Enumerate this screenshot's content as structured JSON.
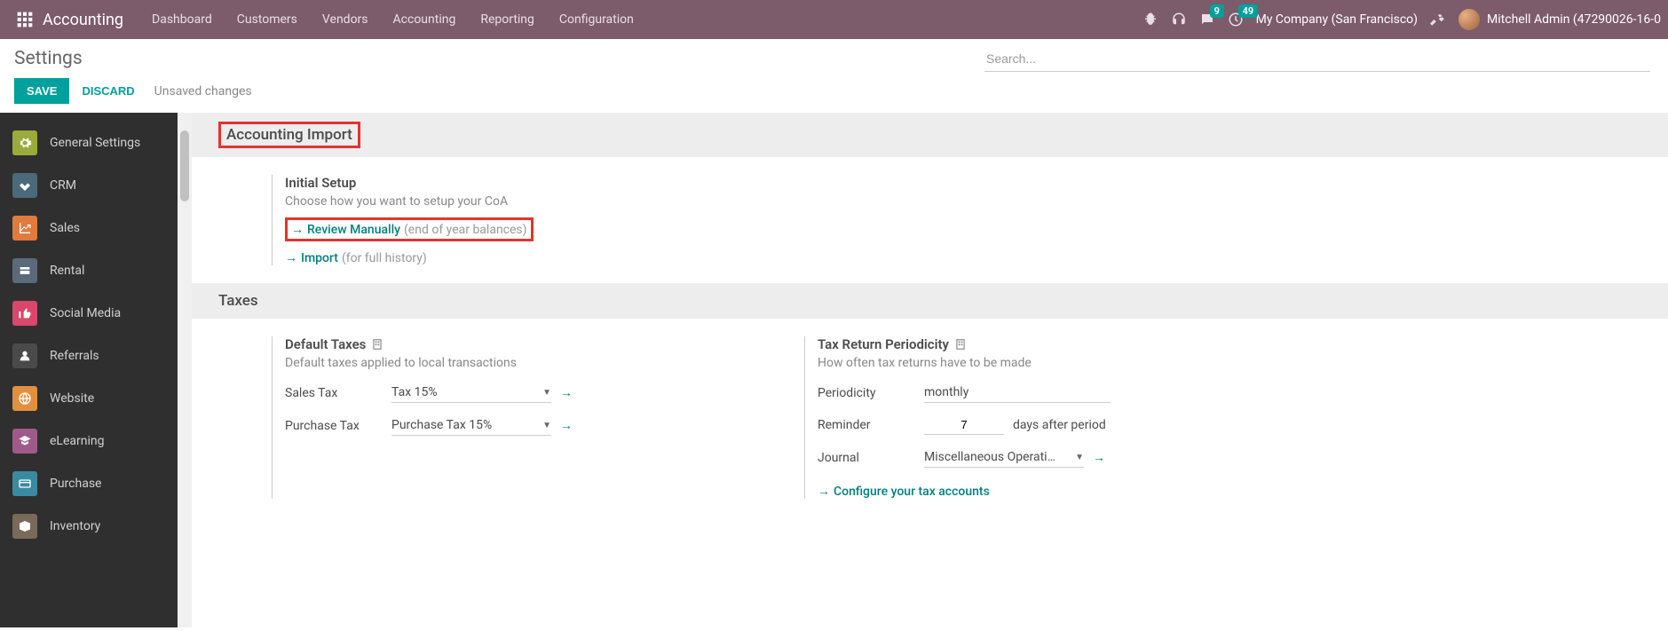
{
  "topnav": {
    "brand": "Accounting",
    "items": [
      "Dashboard",
      "Customers",
      "Vendors",
      "Accounting",
      "Reporting",
      "Configuration"
    ],
    "messages_badge": "9",
    "activities_badge": "49",
    "company": "My Company (San Francisco)",
    "user": "Mitchell Admin (47290026-16-0"
  },
  "controlbar": {
    "title": "Settings",
    "save": "SAVE",
    "discard": "DISCARD",
    "unsaved": "Unsaved changes",
    "search_placeholder": "Search..."
  },
  "sidebar": {
    "items": [
      "General Settings",
      "CRM",
      "Sales",
      "Rental",
      "Social Media",
      "Referrals",
      "Website",
      "eLearning",
      "Purchase",
      "Inventory"
    ]
  },
  "sections": {
    "import": {
      "header": "Accounting Import",
      "initial": {
        "title": "Initial Setup",
        "desc": "Choose how you want to setup your CoA",
        "review": "Review Manually",
        "review_hint": "(end of year balances)",
        "import": "Import",
        "import_hint": "(for full history)"
      }
    },
    "taxes": {
      "header": "Taxes",
      "default": {
        "title": "Default Taxes",
        "desc": "Default taxes applied to local transactions",
        "sales_label": "Sales Tax",
        "sales_value": "Tax 15%",
        "purchase_label": "Purchase Tax",
        "purchase_value": "Purchase Tax 15%"
      },
      "return": {
        "title": "Tax Return Periodicity",
        "desc": "How often tax returns have to be made",
        "periodicity_label": "Periodicity",
        "periodicity_value": "monthly",
        "reminder_label": "Reminder",
        "reminder_value": "7",
        "reminder_after": "days after period",
        "journal_label": "Journal",
        "journal_value": "Miscellaneous Operations",
        "configure": "Configure your tax accounts"
      }
    }
  }
}
